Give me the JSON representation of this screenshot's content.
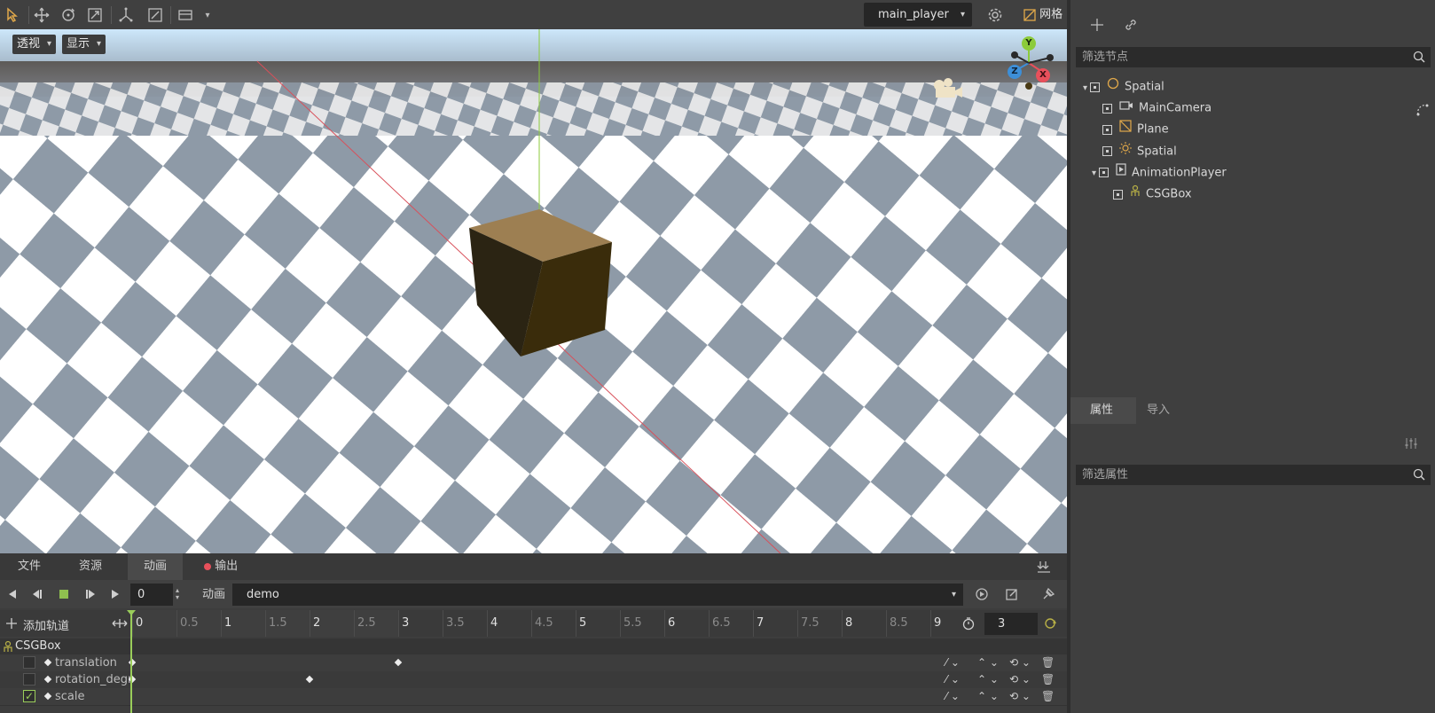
{
  "toolbar": {
    "tools": [
      "select-tool-icon",
      "move-tool-icon",
      "rotate-tool-icon",
      "scale-tool-icon",
      "local-space-icon",
      "snap-icon",
      "view-icon"
    ],
    "animation_player": "main_player",
    "grid_label": "网格"
  },
  "viewport": {
    "perspective_label": "透视",
    "display_label": "显示",
    "gizmo_axes": {
      "x": "X",
      "y": "Y",
      "z": "Z"
    }
  },
  "bottom_panel": {
    "tabs": [
      "文件",
      "资源",
      "动画",
      "输出"
    ],
    "active_tab": "动画",
    "frame": "0",
    "animation_label": "动画",
    "animation_name": "demo",
    "add_track_label": "添加轨道",
    "timeline_ticks": [
      "0",
      "0.5",
      "1",
      "1.5",
      "2",
      "2.5",
      "3",
      "3.5",
      "4",
      "4.5",
      "5",
      "5.5",
      "6",
      "6.5",
      "7",
      "7.5",
      "8",
      "8.5",
      "9"
    ],
    "length": "3",
    "node_name": "CSGBox",
    "tracks": [
      {
        "name": "translation",
        "checked": false,
        "keys": [
          0,
          3
        ]
      },
      {
        "name": "rotation_degr",
        "checked": false,
        "keys": [
          0,
          2
        ]
      },
      {
        "name": "scale",
        "checked": true,
        "keys": []
      }
    ]
  },
  "scene_dock": {
    "filter_placeholder": "筛选节点",
    "tree": [
      {
        "label": "Spatial",
        "icon": "spatial-icon",
        "depth": 0,
        "expanded": true
      },
      {
        "label": "MainCamera",
        "icon": "camera-icon",
        "depth": 1
      },
      {
        "label": "Plane",
        "icon": "mesh-icon",
        "depth": 1
      },
      {
        "label": "Spatial",
        "icon": "light-icon",
        "depth": 1
      },
      {
        "label": "AnimationPlayer",
        "icon": "animation-player-icon",
        "depth": 1,
        "expanded": true
      },
      {
        "label": "CSGBox",
        "icon": "csg-box-icon",
        "depth": 2
      }
    ]
  },
  "inspector_dock": {
    "tabs": [
      "属性",
      "导入"
    ],
    "active_tab": "属性",
    "filter_placeholder": "筛选属性"
  },
  "colors": {
    "panel": "#404040",
    "field": "#262626",
    "accent": "#8fbf4f",
    "x_axis": "#e8505b",
    "y_axis": "#8ccb3b",
    "z_axis": "#3d8fd8"
  }
}
